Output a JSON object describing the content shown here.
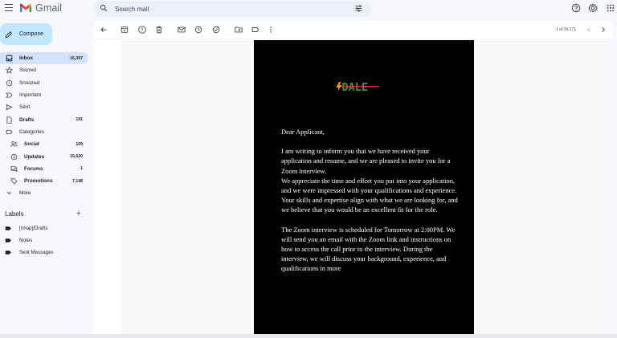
{
  "app": {
    "name": "Gmail",
    "brand_colors": [
      "#4285f4",
      "#ea4335",
      "#fbbc04",
      "#34a853",
      "#c5221f"
    ]
  },
  "search": {
    "placeholder": "Search mail"
  },
  "sidebar": {
    "compose_label": "Compose",
    "items": [
      {
        "label": "Inbox",
        "count": "16,397",
        "icon": "inbox-icon",
        "active": true,
        "bold": true
      },
      {
        "label": "Starred",
        "count": "",
        "icon": "star-icon"
      },
      {
        "label": "Snoozed",
        "count": "",
        "icon": "clock-icon"
      },
      {
        "label": "Important",
        "count": "",
        "icon": "important-icon"
      },
      {
        "label": "Sent",
        "count": "",
        "icon": "send-icon"
      },
      {
        "label": "Drafts",
        "count": "191",
        "icon": "draft-icon",
        "bold": true
      },
      {
        "label": "Categories",
        "count": "",
        "icon": "label-icon"
      },
      {
        "label": "Social",
        "count": "109",
        "icon": "people-icon",
        "bold": true,
        "sub": true
      },
      {
        "label": "Updates",
        "count": "15,620",
        "icon": "info-icon",
        "bold": true,
        "sub": true
      },
      {
        "label": "Forums",
        "count": "1",
        "icon": "forum-icon",
        "bold": true,
        "sub": true
      },
      {
        "label": "Promotions",
        "count": "7,148",
        "icon": "tag-icon",
        "bold": true,
        "sub": true
      },
      {
        "label": "More",
        "count": "",
        "icon": "chevron-down-icon"
      }
    ],
    "labels_header": "Labels",
    "labels": [
      {
        "label": "[Imap]/Drafts"
      },
      {
        "label": "Notes"
      },
      {
        "label": "Sent Messages"
      }
    ]
  },
  "toolbar": {
    "pager": "1 of 24,171"
  },
  "email": {
    "brand_text": "DALE",
    "brand_color": "#2e9d4e",
    "brand_accent": "#e53935",
    "greeting": "Dear Applicant,",
    "paragraph1": "I am writing to inform you that we have received your application and resume, and we are pleased to invite you for a Zoom interview.",
    "paragraph2": "We appreciate the time and effort you put into your application, and we were impressed with your qualifications and experience.",
    "paragraph3": "Your skills and expertise align with what we are looking for, and we believe that you would be an excellent fit for the role.",
    "paragraph4": "The Zoom interview is scheduled for Tomorrow at 2:00PM. We will send you an email with the Zoom link and instructions on how to access the call prior to the interview. During the interview, we will discuss your background, experience, and qualifications in more"
  }
}
